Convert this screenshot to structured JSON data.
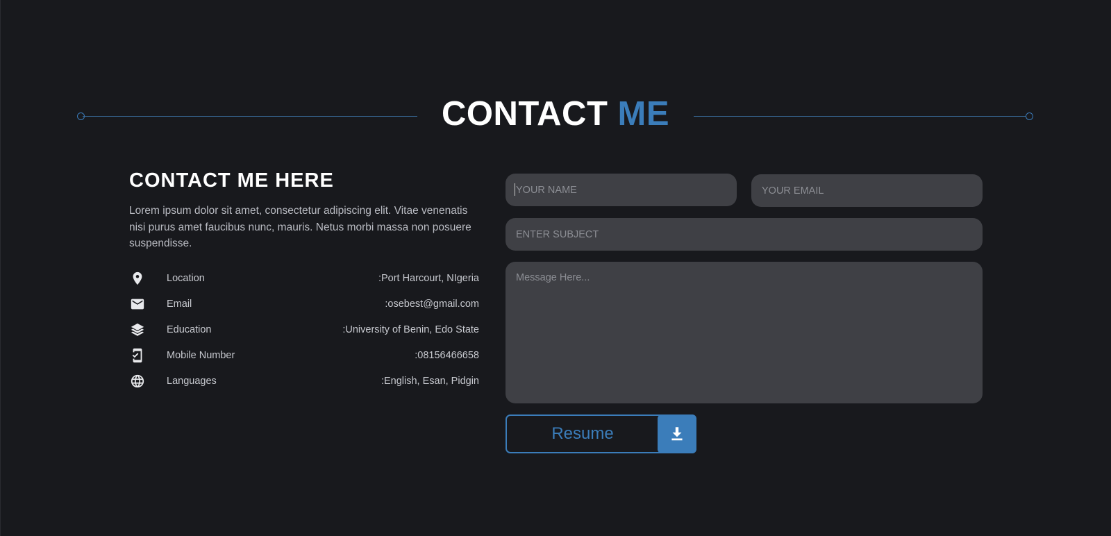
{
  "header": {
    "title_main": "CONTACT",
    "title_accent": "ME"
  },
  "info": {
    "heading": "CONTACT ME HERE",
    "description": "Lorem ipsum dolor sit amet, consectetur adipiscing elit. Vitae venenatis nisi purus amet faucibus nunc, mauris. Netus morbi massa non posuere suspendisse.",
    "items": [
      {
        "icon": "location-pin-icon",
        "label": "Location",
        "value": ":Port Harcourt, NIgeria"
      },
      {
        "icon": "mail-icon",
        "label": "Email",
        "value": ":osebest@gmail.com"
      },
      {
        "icon": "graduation-icon",
        "label": "Education",
        "value": ":University of Benin, Edo State"
      },
      {
        "icon": "mobile-phone-icon",
        "label": "Mobile Number",
        "value": ":08156466658"
      },
      {
        "icon": "globe-icon",
        "label": "Languages",
        "value": ":English, Esan, Pidgin"
      }
    ]
  },
  "form": {
    "name_placeholder": "YOUR NAME",
    "email_placeholder": "YOUR EMAIL",
    "subject_placeholder": "ENTER SUBJECT",
    "message_placeholder": "Message Here...",
    "resume_label": "Resume",
    "resume_icon": "download-icon"
  },
  "colors": {
    "background": "#18191d",
    "accent": "#3b7dba",
    "field": "#3f4045"
  }
}
